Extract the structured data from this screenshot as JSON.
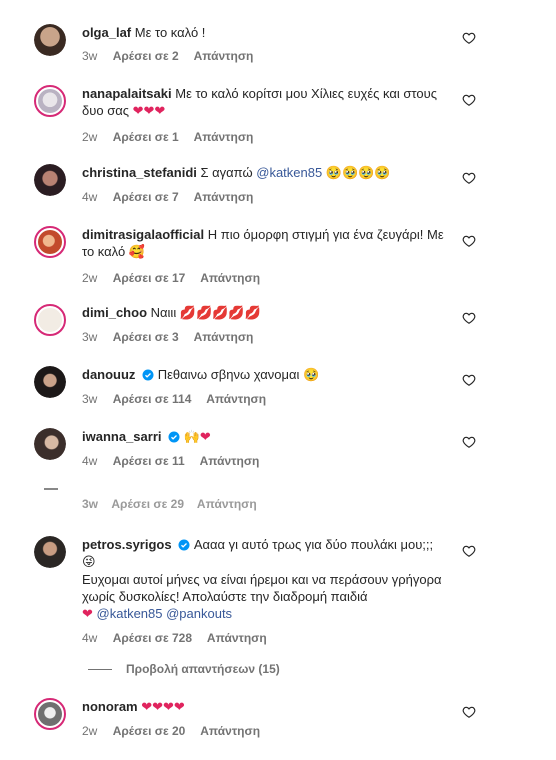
{
  "comments": [
    {
      "user": "olga_laf",
      "text": "Με το καλό !",
      "time": "3w",
      "likes": "Αρέσει σε 2",
      "reply": "Απάντηση"
    },
    {
      "user": "nanapalaitsaki",
      "text": "Με το καλό κορίτσι μου Χίλιες ευχές και στους δυο σας",
      "emojis": "❤❤❤",
      "time": "2w",
      "likes": "Αρέσει σε 1",
      "reply": "Απάντηση"
    },
    {
      "user": "christina_stefanidi",
      "text": "Σ αγαπώ",
      "mention": "@katken85",
      "tail": "🥹🥹🥹🥹",
      "time": "4w",
      "likes": "Αρέσει σε 7",
      "reply": "Απάντηση"
    },
    {
      "user": "dimitrasigalaofficial",
      "text": "Η πιο όμορφη στιγμή για ένα ζευγάρι! Με το καλό",
      "emojis": "🥰",
      "time": "2w",
      "likes": "Αρέσει σε 17",
      "reply": "Απάντηση"
    },
    {
      "user": "dimi_choo",
      "text": "Ναιιι",
      "emojis": "💋💋💋💋💋",
      "time": "3w",
      "likes": "Αρέσει σε 3",
      "reply": "Απάντηση"
    },
    {
      "user": "danouuz",
      "text": "Πεθαινω σβηνω χανομαι",
      "tail": "🥹",
      "time": "3w",
      "likes": "Αρέσει σε 114",
      "reply": "Απάντηση"
    },
    {
      "user": "iwanna_sarri",
      "emojis": "🙌❤",
      "time": "4w",
      "likes": "Αρέσει σε 11",
      "reply": "Απάντηση"
    },
    {
      "user": "petros.syrigos",
      "text": "Αααα γι αυτό τρως για δύο πουλάκι μου;;;",
      "emojis": "😜",
      "text2": "Ευχομαι αυτοί μήνες να είναι ήρεμοι και να περάσουν γρήγορα χωρίς δυσκολίες! Απολαύστε την διαδρομή παιδιά",
      "mention": "@katken85 @pankouts",
      "time": "4w",
      "likes": "Αρέσει σε 728",
      "reply": "Απάντηση"
    },
    {
      "user": "nonoram",
      "emojis": "❤❤❤❤",
      "time": "2w",
      "likes": "Αρέσει σε 20",
      "reply": "Απάντηση"
    }
  ],
  "faded_meta": {
    "time": "3w",
    "likes": "Αρέσει σε 29",
    "reply": "Απάντηση"
  },
  "view_replies": "Προβολή απαντήσεων (15)",
  "colors": {
    "heart": "#e0245e",
    "mention": "#385898",
    "meta": "#737373",
    "verified": "#0095f6"
  }
}
